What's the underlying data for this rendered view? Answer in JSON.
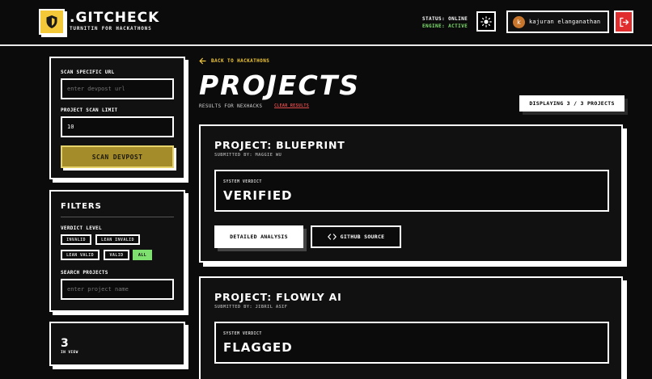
{
  "header": {
    "brand": ".GITCHECK",
    "tagline": "TURNITIN FOR HACKATHONS",
    "status_line": "STATUS: ONLINE",
    "engine_line": "ENGINE: ACTIVE",
    "user": {
      "initial": "k",
      "name": "kajuran elanganathan"
    },
    "icons": {
      "logo": "shield-icon",
      "theme": "sun-icon",
      "logout": "logout-icon"
    },
    "colors": {
      "accent": "#f3c93a",
      "engine": "#7ee06e",
      "logout": "#e02e2e"
    }
  },
  "sidebar": {
    "scan": {
      "url_label": "SCAN SPECIFIC URL",
      "url_placeholder": "enter devpost url",
      "limit_label": "PROJECT SCAN LIMIT",
      "limit_value": "10",
      "scan_button": "SCAN DEVPOST"
    },
    "filters": {
      "title": "FILTERS",
      "verdict_label": "VERDICT LEVEL",
      "chips": [
        "INVALID",
        "LEAN INVALID",
        "LEAN VALID",
        "VALID",
        "ALL"
      ],
      "active_chip": "ALL",
      "search_label": "SEARCH PROJECTS",
      "search_placeholder": "enter project name"
    },
    "count": {
      "value": "3",
      "label": "IN VIEW"
    }
  },
  "main": {
    "back_link": "BACK TO HACKATHONS",
    "title": "PROJECTS",
    "results_for": "RESULTS FOR NEXHACKS",
    "clear_results": "CLEAR RESULTS",
    "displaying": "DISPLAYING 3 / 3 PROJECTS",
    "projects": [
      {
        "title": "PROJECT: BLUEPRINT",
        "submitted_by": "SUBMITTED BY: MAGGIE WU",
        "verdict_label": "SYSTEM VERDICT",
        "verdict": "VERIFIED",
        "analysis_button": "DETAILED ANALYSIS",
        "github_button": "GITHUB SOURCE"
      },
      {
        "title": "PROJECT: FLOWLY AI",
        "submitted_by": "SUBMITTED BY: JIBRIL ASIF",
        "verdict_label": "SYSTEM VERDICT",
        "verdict": "FLAGGED"
      }
    ]
  }
}
